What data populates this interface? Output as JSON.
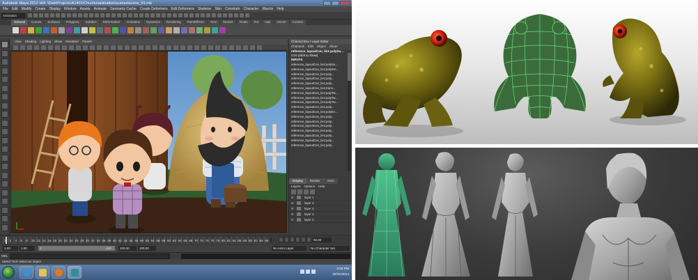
{
  "maya": {
    "window_title": "Autodesk Maya 2012 x64: \\Dab\\Projects\\A1401\\Chuchu\\animation\\scenes\\scene_01.mb",
    "menus": [
      "File",
      "Edit",
      "Modify",
      "Create",
      "Display",
      "Window",
      "Assets",
      "Animate",
      "Geometry Cache",
      "Create Deformers",
      "Edit Deformers",
      "Skeleton",
      "Skin",
      "Constrain",
      "Character",
      "Muscle",
      "Help"
    ],
    "mode": "Animation",
    "shelf_tabs": [
      "General",
      "Curves",
      "Surfaces",
      "Polygons",
      "Subdivs",
      "Deformation",
      "Animation",
      "Dynamics",
      "Rendering",
      "PaintEffects",
      "Toon",
      "Muscle",
      "Fluids",
      "Fur",
      "Hair",
      "nCloth",
      "Custom"
    ],
    "active_shelf_tab": "General",
    "viewport_menus": [
      "View",
      "Shading",
      "Lighting",
      "Show",
      "Renderer",
      "Panels"
    ],
    "channel_box": {
      "title": "Channel Box / Layer Editor",
      "menus": [
        "Channels",
        "Edit",
        "Object",
        "Show"
      ],
      "node_name": "reference_layoutCon_lie1:polySu...",
      "node_sub": "CVs (click to show)",
      "inputs_label": "INPUTS",
      "inputs": [
        "reference_layoutCon_lie1:polySu...",
        "reference_layoutCon_lie1:polySm...",
        "reference_layoutCon_lie1:poly...",
        "reference_layoutCon_lie1:poly...",
        "reference_layoutCon_lie1:poly...",
        "reference_layoutCon_lie1:trans...",
        "reference_layoutCon_lie1:polyTw...",
        "reference_layoutCon_lie1:polyTw...",
        "reference_layoutCon_lie1:polyTw...",
        "reference_layoutCon_lie1:poly...",
        "reference_layoutCon_lie1:polyEx...",
        "reference_layoutCon_lie1:poly...",
        "reference_layoutCon_lie1:poly...",
        "reference_layoutCon_lie1:poly...",
        "reference_layoutCon_lie1:poly...",
        "reference_layoutCon_lie1:poly...",
        "reference_layoutCon_lie1:poly...",
        "reference_layoutCon_lie1:poly..."
      ]
    },
    "layer_editor": {
      "tabs": [
        "Display",
        "Render",
        "Anim"
      ],
      "active_tab": "Display",
      "menus": [
        "Layers",
        "Options",
        "Help"
      ],
      "layers": [
        {
          "v": "V",
          "name": "layer 1"
        },
        {
          "v": "V",
          "name": "layer 3"
        },
        {
          "v": "V",
          "name": "layer 3"
        },
        {
          "v": "V",
          "name": "layer 2"
        },
        {
          "v": "V",
          "name": "layer 2"
        }
      ]
    },
    "time_slider": {
      "ticks": [
        "1",
        "2",
        "4",
        "6",
        "8",
        "10",
        "12",
        "14",
        "16",
        "18",
        "20",
        "22",
        "24",
        "26",
        "28",
        "30",
        "32",
        "34",
        "36",
        "38",
        "40",
        "42",
        "44",
        "46",
        "48",
        "50",
        "52",
        "54",
        "56",
        "58",
        "60",
        "62",
        "64",
        "66",
        "68",
        "70",
        "72",
        "74",
        "76",
        "78",
        "80",
        "82",
        "84",
        "86",
        "88",
        "90",
        "92",
        "94",
        "96"
      ],
      "current_frame": "92.00"
    },
    "range_slider": {
      "start": "1.00",
      "start2": "1.00",
      "range_label": "1",
      "end_label": "100",
      "end": "100.00",
      "end2": "100.00",
      "anim_layer": "No Anim Layer",
      "character_set": "No Character Set"
    },
    "command_line": {
      "label": "MEL"
    },
    "help_line": "Select Tool: select an object",
    "taskbar": {
      "time": "3:26 PM",
      "date": "10/31/2014"
    }
  }
}
